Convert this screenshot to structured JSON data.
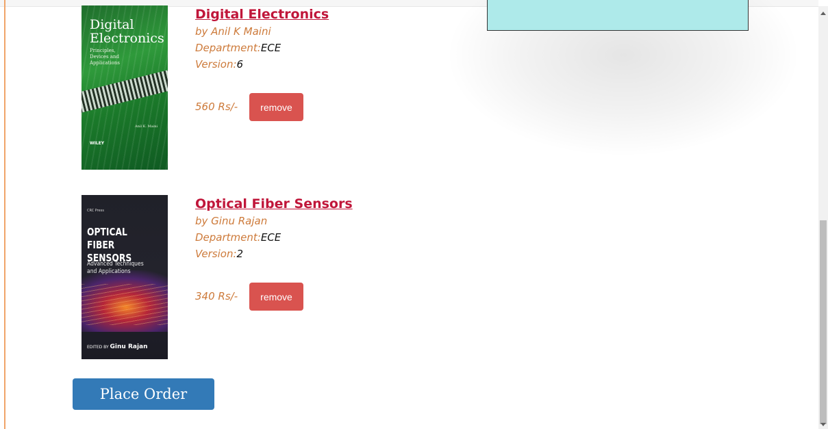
{
  "books": [
    {
      "title": "Digital Electronics",
      "author": "by Anil K Maini",
      "department_label": "Department:",
      "department": "ECE",
      "version_label": "Version:",
      "version": "6",
      "price": "560 Rs/-",
      "remove_label": "remove",
      "cover": {
        "title_line1": "Digital",
        "title_line2": "Electronics",
        "subtitle": "Principles, Devices and Applications",
        "author": "Anil K. Maini",
        "publisher": "WILEY"
      }
    },
    {
      "title": "Optical Fiber Sensors",
      "author": "by Ginu Rajan",
      "department_label": "Department:",
      "department": "ECE",
      "version_label": "Version:",
      "version": "2",
      "price": "340 Rs/-",
      "remove_label": "remove",
      "cover": {
        "publisher": "CRC Press",
        "title_line1": "OPTICAL FIBER",
        "title_line2": "SENSORS",
        "subtitle_line1": "Advanced Techniques",
        "subtitle_line2": "and Applications",
        "edited_by": "EDITED BY",
        "editor": "Ginu Rajan"
      }
    }
  ],
  "place_order_label": "Place Order",
  "colors": {
    "title": "#c0163a",
    "meta": "#cd7a3a",
    "remove_button": "#d9534f",
    "place_order_button": "#337ab7",
    "panel": "#aeeaea"
  }
}
